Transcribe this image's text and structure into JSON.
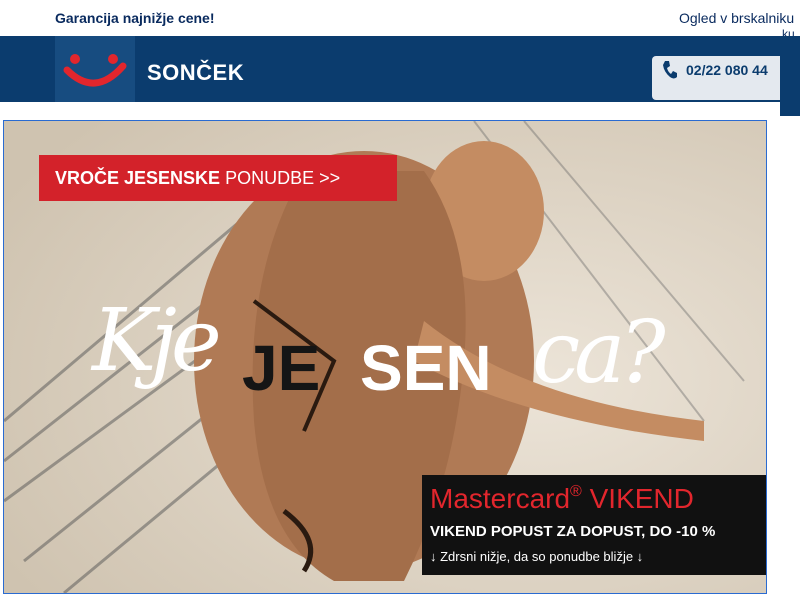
{
  "topbar": {
    "guarantee": "Garancija najnižje cene!",
    "browser_link": "Ogled v brskalniku",
    "browser_link_overflow": "ku"
  },
  "header": {
    "brand": "SONČEK",
    "phone": "02/22 080 44",
    "logo_icon": "tui-smile-logo",
    "phone_icon": "phone-icon"
  },
  "hero": {
    "promo_bold": "VROČE JESENSKE",
    "promo_rest": " PONUDBE >>",
    "script_left": "Kje",
    "bold_dark": "JE",
    "bold_white": "SEN",
    "script_right": "ca?",
    "offer": {
      "brand": "Mastercard",
      "reg_mark": "®",
      "title_rest": " VIKEND",
      "subtitle": "VIKEND POPUST ZA DOPUST, DO -10 %",
      "scroll_hint": "↓ Zdrsni nižje, da so ponudbe bližje ↓"
    }
  },
  "colors": {
    "navy": "#0b3c6e",
    "promo_red": "#d3222a",
    "mastercard_red": "#e2262d",
    "highlight_blue": "#2a6bd1"
  }
}
